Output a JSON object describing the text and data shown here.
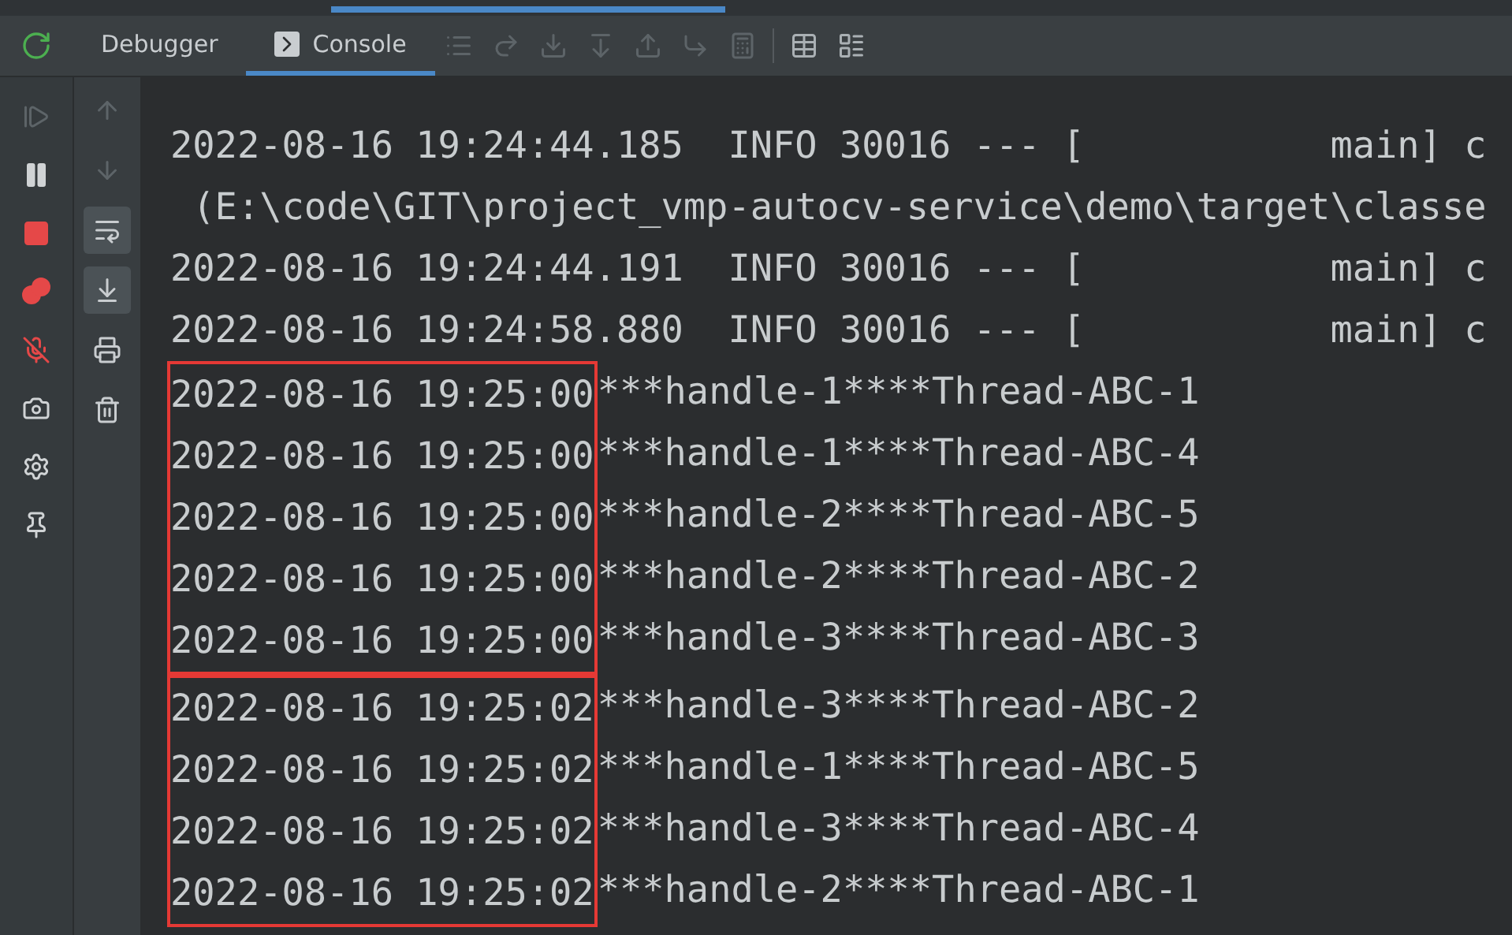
{
  "tabs": [
    {
      "label": "Debugger",
      "selected": false,
      "kind": "plain"
    },
    {
      "label": "Console",
      "selected": true,
      "kind": "console"
    }
  ],
  "debug_actions": [
    {
      "kind": "frames",
      "disabled": true
    },
    {
      "kind": "step-over",
      "disabled": true
    },
    {
      "kind": "step-into",
      "disabled": true
    },
    {
      "kind": "force-step-into",
      "disabled": true
    },
    {
      "kind": "step-out",
      "disabled": true
    },
    {
      "kind": "run-to-cursor",
      "disabled": true
    },
    {
      "kind": "evaluate",
      "disabled": true
    }
  ],
  "view_actions": [
    {
      "kind": "table",
      "disabled": false
    },
    {
      "kind": "layout",
      "disabled": false
    }
  ],
  "side_tools": [
    {
      "kind": "resume",
      "disabled": true
    },
    {
      "kind": "pause",
      "disabled": false
    },
    {
      "kind": "stop",
      "disabled": false
    },
    {
      "kind": "breakpoints",
      "disabled": false
    },
    {
      "kind": "mute",
      "disabled": false
    },
    {
      "kind": "camera",
      "disabled": false
    },
    {
      "kind": "settings",
      "disabled": false
    },
    {
      "kind": "pin",
      "disabled": false
    }
  ],
  "console_tools": [
    {
      "kind": "up",
      "disabled": true,
      "toggled": false
    },
    {
      "kind": "down",
      "disabled": true,
      "toggled": false
    },
    {
      "kind": "wrap",
      "disabled": false,
      "toggled": true
    },
    {
      "kind": "scroll-end",
      "disabled": false,
      "toggled": true
    },
    {
      "kind": "print",
      "disabled": false,
      "toggled": false
    },
    {
      "kind": "trash",
      "disabled": false,
      "toggled": false
    }
  ],
  "log_groups": [
    {
      "lines": [
        {
          "text": "2022-08-16 19:24:44.185  INFO 30016 --- [           main] c"
        },
        {
          "text": " (E:\\code\\GIT\\project_vmp-autocv-service\\demo\\target\\classe"
        },
        {
          "text": "2022-08-16 19:24:44.191  INFO 30016 --- [           main] c"
        },
        {
          "text": "2022-08-16 19:24:58.880  INFO 30016 --- [           main] c"
        }
      ]
    },
    {
      "boxed": true,
      "lines": [
        {
          "timestamp": "2022-08-16 19:25:00",
          "message": "***handle-1****Thread-ABC-1"
        },
        {
          "timestamp": "2022-08-16 19:25:00",
          "message": "***handle-1****Thread-ABC-4"
        },
        {
          "timestamp": "2022-08-16 19:25:00",
          "message": "***handle-2****Thread-ABC-5"
        },
        {
          "timestamp": "2022-08-16 19:25:00",
          "message": "***handle-2****Thread-ABC-2"
        },
        {
          "timestamp": "2022-08-16 19:25:00",
          "message": "***handle-3****Thread-ABC-3"
        }
      ]
    },
    {
      "boxed": true,
      "lines": [
        {
          "timestamp": "2022-08-16 19:25:02",
          "message": "***handle-3****Thread-ABC-2"
        },
        {
          "timestamp": "2022-08-16 19:25:02",
          "message": "***handle-1****Thread-ABC-5"
        },
        {
          "timestamp": "2022-08-16 19:25:02",
          "message": "***handle-3****Thread-ABC-4"
        },
        {
          "timestamp": "2022-08-16 19:25:02",
          "message": "***handle-2****Thread-ABC-1"
        }
      ]
    }
  ]
}
